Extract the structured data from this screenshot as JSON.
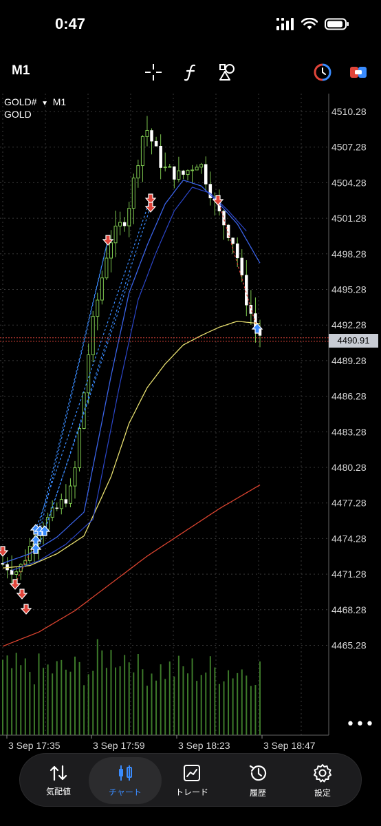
{
  "status": {
    "time": "0:47"
  },
  "toolbar": {
    "timeframe": "M1"
  },
  "chart": {
    "symbol": "GOLD#",
    "timeframe": "M1",
    "description": "GOLD",
    "current_price": "4490.91",
    "price_axis": [
      "4510.28",
      "4507.28",
      "4504.28",
      "4501.28",
      "4498.28",
      "4495.28",
      "4492.28",
      "4489.28",
      "4486.28",
      "4483.28",
      "4480.28",
      "4477.28",
      "4474.28",
      "4471.28",
      "4468.28",
      "4465.28"
    ],
    "time_axis": [
      "3 Sep 17:35",
      "3 Sep 17:59",
      "3 Sep 18:23",
      "3 Sep 18:47"
    ],
    "colors": {
      "bull": "#7ec850",
      "ma_fast": "#2b46c9",
      "ma_fast2": "#3a63e8",
      "ma_mid": "#e8e070",
      "ma_slow": "#d9432f",
      "sell_arrow": "#e0453a",
      "buy_arrow": "#3a8cff"
    }
  },
  "chart_data": {
    "type": "line",
    "title": "",
    "x": [
      "3 Sep 17:35",
      "3 Sep 17:59",
      "3 Sep 18:23",
      "3 Sep 18:47"
    ],
    "ylim": [
      4463.5,
      4512.5
    ],
    "series": [
      {
        "x": [
          0,
          4,
          8,
          12,
          16,
          20,
          24,
          28,
          32,
          36,
          40,
          44,
          48,
          52,
          54,
          57
        ],
        "values": [
          4472.2,
          4471.5,
          4474.8,
          4476.5,
          4478.5,
          4491.5,
          4499.2,
          4501.5,
          4509.2,
          4505.5,
          4504.8,
          4506.2,
          4502.0,
          4499.0,
          4495.0,
          4491.5
        ]
      },
      {
        "x": [
          0,
          6,
          12,
          18,
          24,
          28,
          32,
          36,
          40,
          44,
          48,
          52,
          57
        ],
        "values": [
          4472.2,
          4473.0,
          4474.4,
          4476.5,
          4488.0,
          4495.0,
          4499.0,
          4502.5,
          4504.5,
          4504.0,
          4502.5,
          4500.8,
          4497.5
        ]
      },
      {
        "x": [
          0,
          6,
          12,
          18,
          24,
          28,
          32,
          36,
          40,
          44,
          48,
          52,
          57
        ],
        "values": [
          4471.8,
          4472.0,
          4473.0,
          4474.5,
          4479.5,
          4484.0,
          4487.0,
          4489.0,
          4490.6,
          4491.4,
          4492.1,
          4492.6,
          4492.4
        ]
      },
      {
        "x": [
          0,
          8,
          16,
          24,
          32,
          40,
          48,
          57
        ],
        "values": [
          4465.2,
          4466.4,
          4468.2,
          4470.5,
          4472.8,
          4474.8,
          4476.8,
          4478.8
        ]
      }
    ],
    "grid": true
  },
  "tabs": [
    {
      "label": "気配値",
      "icon": "quotes-icon"
    },
    {
      "label": "チャート",
      "icon": "chart-icon"
    },
    {
      "label": "トレード",
      "icon": "trade-icon"
    },
    {
      "label": "履歴",
      "icon": "history-icon"
    },
    {
      "label": "設定",
      "icon": "settings-icon"
    }
  ]
}
